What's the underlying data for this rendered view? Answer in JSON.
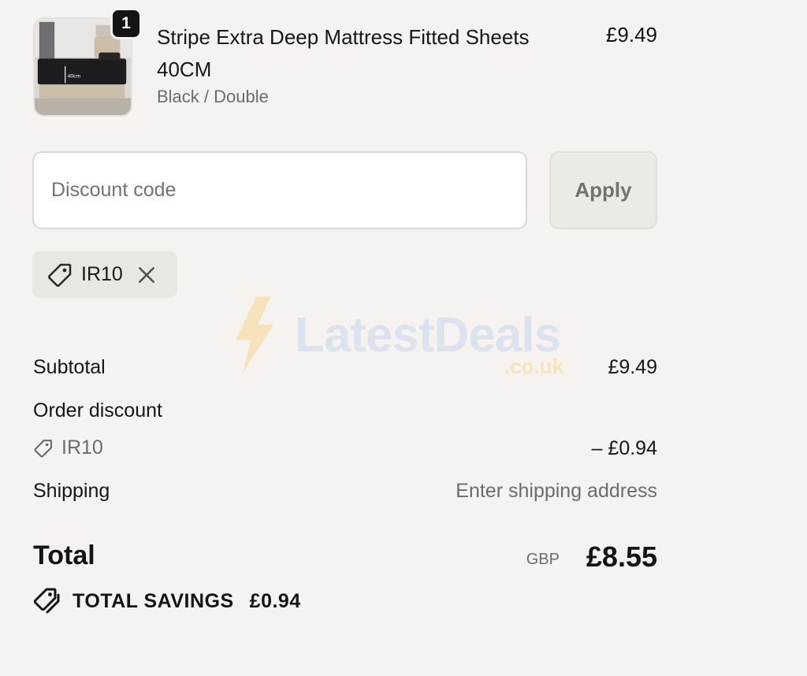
{
  "cart_item": {
    "quantity": "1",
    "title": "Stripe Extra Deep Mattress Fitted Sheets 40CM",
    "variant": "Black / Double",
    "price": "£9.49",
    "image_label": "40cm"
  },
  "discount": {
    "placeholder": "Discount code",
    "apply_label": "Apply",
    "applied_code": "IR10"
  },
  "watermark": {
    "name": "LatestDeals",
    "domain": ".co.uk"
  },
  "summary": {
    "subtotal_label": "Subtotal",
    "subtotal_value": "£9.49",
    "order_discount_label": "Order discount",
    "discount_code": "IR10",
    "discount_value": "– £0.94",
    "shipping_label": "Shipping",
    "shipping_value": "Enter shipping address",
    "total_label": "Total",
    "total_currency": "GBP",
    "total_value": "£8.55",
    "savings_label": "TOTAL SAVINGS",
    "savings_value": "£0.94"
  },
  "colors": {
    "background": "#f6f2ef",
    "text": "#141414",
    "muted": "#6f6b68"
  }
}
